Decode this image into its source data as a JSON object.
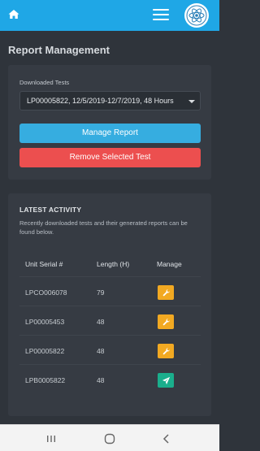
{
  "header": {
    "icons": {
      "home": "home-icon",
      "menu": "hamburger-menu-icon",
      "logo": "atom-logo-icon"
    },
    "accent_color": "#1fa7e6"
  },
  "page": {
    "title": "Report Management"
  },
  "report_form": {
    "field_label": "Downloaded Tests",
    "selected_test": "LP00005822, 12/5/2019-12/7/2019, 48 Hours",
    "manage_button": "Manage Report",
    "remove_button": "Remove Selected Test",
    "colors": {
      "manage": "#36ade0",
      "remove": "#ec4f4f"
    }
  },
  "activity": {
    "title": "LATEST ACTIVITY",
    "description": "Recently downloaded tests and their generated reports can be found below.",
    "columns": [
      "Unit Serial #",
      "Length (H)",
      "Manage"
    ],
    "rows": [
      {
        "serial": "LPCO006078",
        "length": "79",
        "action": "wrench-icon",
        "action_color": "#f2a922"
      },
      {
        "serial": "LP00005453",
        "length": "48",
        "action": "wrench-icon",
        "action_color": "#f2a922"
      },
      {
        "serial": "LP00005822",
        "length": "48",
        "action": "wrench-icon",
        "action_color": "#f2a922"
      },
      {
        "serial": "LPB0005822",
        "length": "48",
        "action": "send-icon",
        "action_color": "#1aae8c"
      }
    ]
  },
  "system_nav": {
    "icons": [
      "recent-apps-icon",
      "home-circle-icon",
      "back-icon"
    ]
  }
}
